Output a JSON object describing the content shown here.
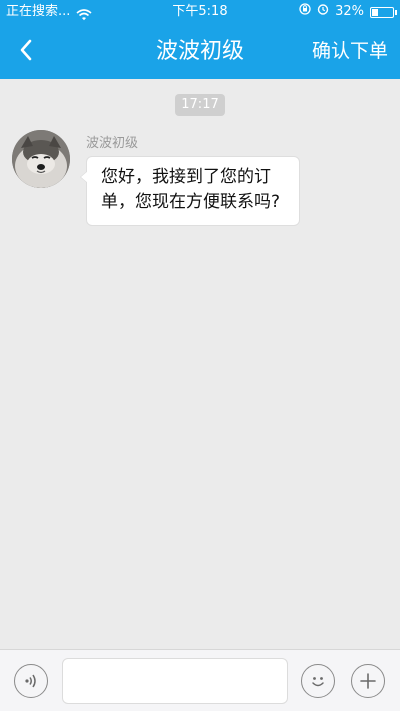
{
  "status_bar": {
    "carrier": "正在搜索...",
    "time": "下午5:18",
    "battery_percent_label": "32%",
    "battery_level": 0.32,
    "icons": [
      "wifi-icon",
      "lock-rotation-icon",
      "alarm-icon",
      "battery-icon"
    ]
  },
  "nav": {
    "title": "波波初级",
    "action_label": "确认下单",
    "back_icon": "chevron-left-icon"
  },
  "chat": {
    "timestamp": "17:17",
    "messages": [
      {
        "sender": "波波初级",
        "text": "您好，我接到了您的订单，您现在方便联系吗?",
        "avatar_icon": "dog-avatar"
      }
    ]
  },
  "input_bar": {
    "text_value": "",
    "voice_icon": "voice-wave-icon",
    "emoji_icon": "smiley-icon",
    "plus_icon": "plus-icon"
  },
  "colors": {
    "accent": "#1aa3e8",
    "background": "#ebebeb"
  }
}
